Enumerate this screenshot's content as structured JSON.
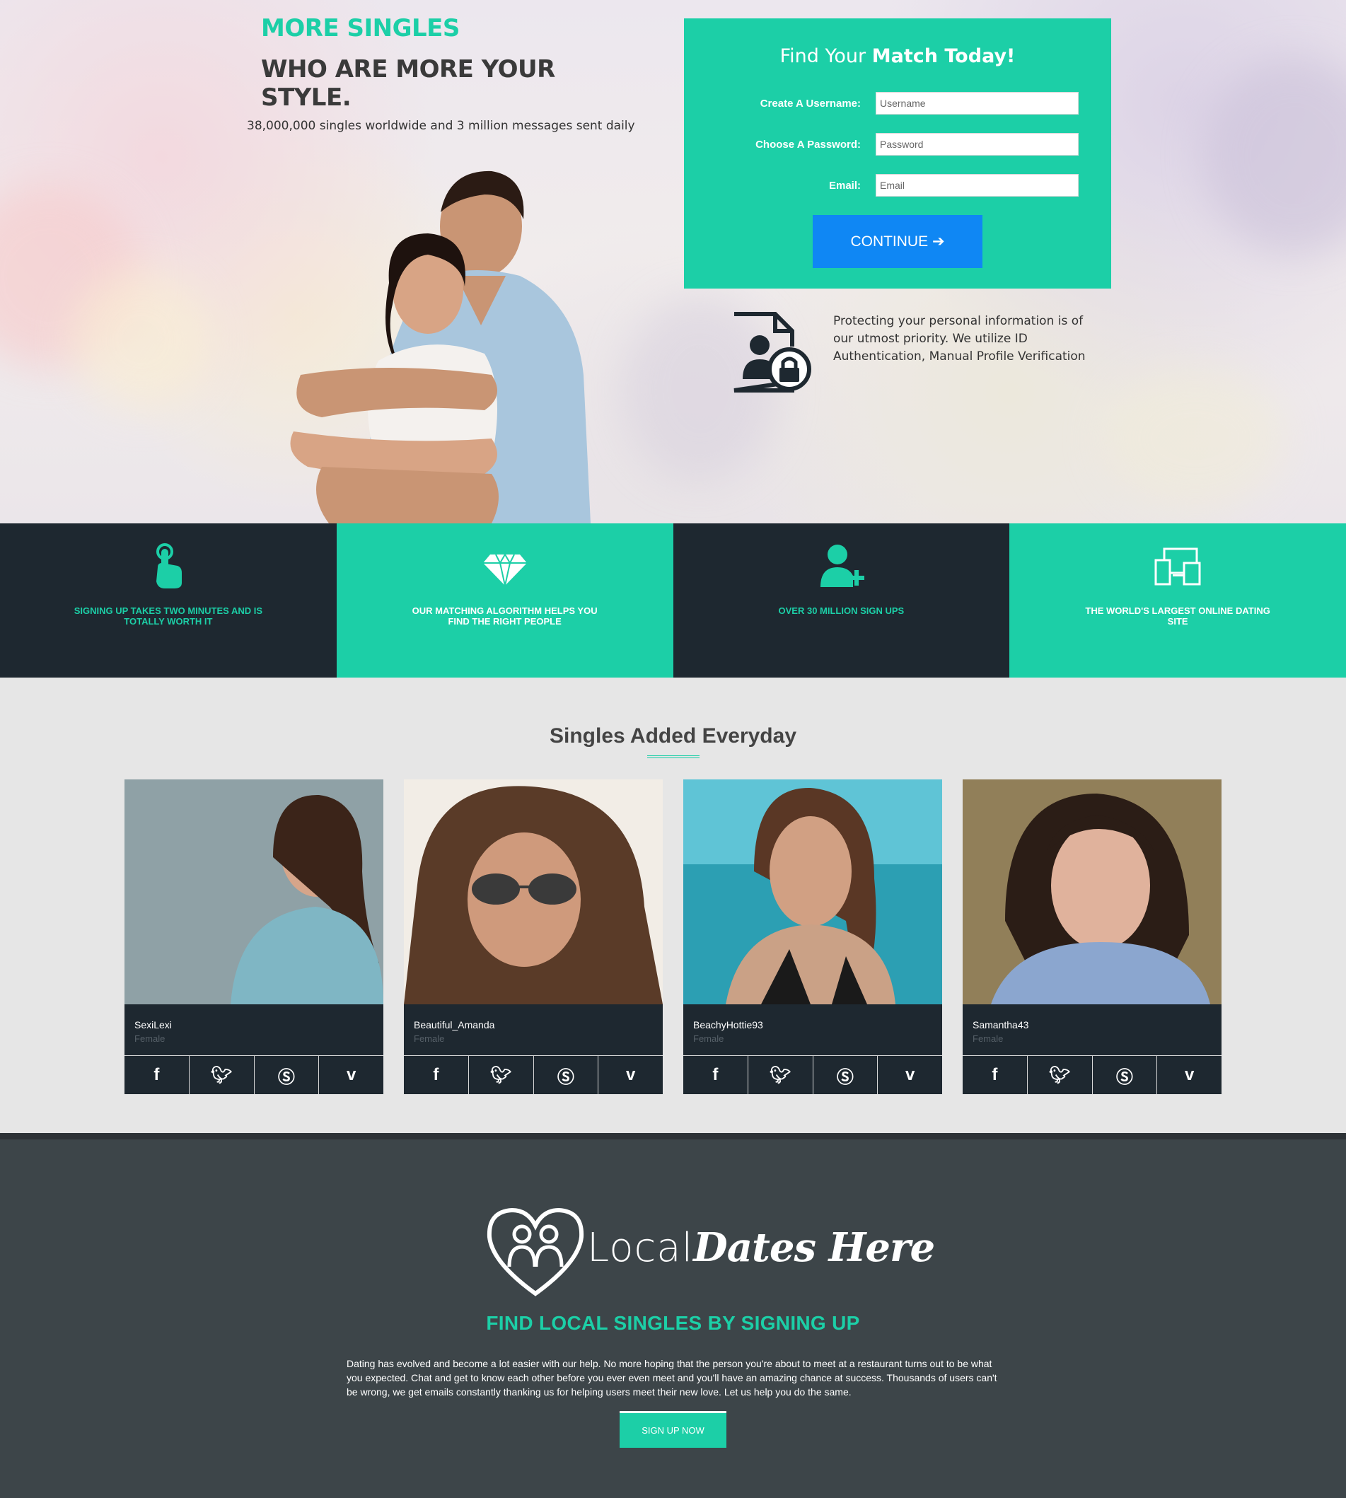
{
  "hero": {
    "tagline_top": "MORE SINGLES",
    "tagline_main": "WHO ARE MORE YOUR STYLE.",
    "stat_line": "38,000,000 singles worldwide and 3 million messages sent daily"
  },
  "signup_form": {
    "title_plain": "Find Your ",
    "title_bold": "Match Today!",
    "username_label": "Create A Username:",
    "username_placeholder": "Username",
    "password_label": "Choose A Password:",
    "password_placeholder": "Password",
    "email_label": "Email:",
    "email_placeholder": "Email",
    "continue_label": "CONTINUE ➔"
  },
  "security": {
    "text": "Protecting your personal information is of our utmost priority. We utilize ID Authentication, Manual Profile Verification"
  },
  "features": [
    {
      "icon": "tap-hand-icon",
      "text": "SIGNING UP TAKES TWO MINUTES AND IS TOTALLY WORTH IT"
    },
    {
      "icon": "diamond-icon",
      "text": "OUR MATCHING ALGORITHM HELPS YOU FIND THE RIGHT PEOPLE"
    },
    {
      "icon": "add-user-icon",
      "text": "OVER 30 MILLION SIGN UPS"
    },
    {
      "icon": "devices-icon",
      "text": "THE WORLD'S LARGEST ONLINE DATING SITE"
    }
  ],
  "singles": {
    "title": "Singles Added Everyday",
    "profiles": [
      {
        "name": "SexiLexi",
        "gender": "Female"
      },
      {
        "name": "Beautiful_Amanda",
        "gender": "Female"
      },
      {
        "name": "BeachyHottie93",
        "gender": "Female"
      },
      {
        "name": "Samantha43",
        "gender": "Female"
      }
    ],
    "social_icons": [
      "facebook-icon",
      "twitter-icon",
      "skype-icon",
      "vimeo-icon"
    ]
  },
  "footer": {
    "logo_light": "Local",
    "logo_bold": "Dates Here",
    "title": "FIND LOCAL SINGLES BY SIGNING UP",
    "about": "Dating has evolved and become a lot easier with our help. No more hoping that the person you're about to meet at a restaurant turns out to be what you expected. Chat and get to know each other before you ever even meet and you'll have an amazing chance at success. Thousands of users can't be wrong, we get emails constantly thanking us for helping users meet their new love. Let us help you do the same.",
    "signup_label": "SIGN UP NOW"
  },
  "colors": {
    "accent": "#1ccfa7",
    "dark": "#1e2830",
    "button_blue": "#0f87f4",
    "footer_bg": "#3d4549"
  }
}
